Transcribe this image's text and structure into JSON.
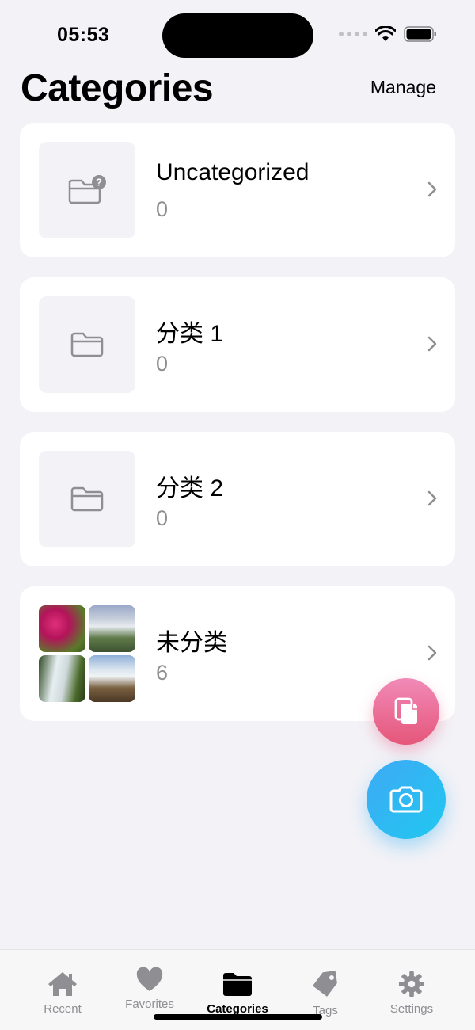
{
  "status": {
    "time": "05:53"
  },
  "header": {
    "title": "Categories",
    "manage_label": "Manage"
  },
  "categories": [
    {
      "name": "Uncategorized",
      "count": "0",
      "icon": "folder-question-icon"
    },
    {
      "name": "分类 1",
      "count": "0",
      "icon": "folder-icon"
    },
    {
      "name": "分类 2",
      "count": "0",
      "icon": "folder-icon"
    },
    {
      "name": "未分类",
      "count": "6",
      "icon": "photo-grid"
    }
  ],
  "fabs": {
    "paste_icon": "paste-icon",
    "camera_icon": "camera-icon"
  },
  "tabs": [
    {
      "label": "Recent",
      "icon": "house-icon"
    },
    {
      "label": "Favorites",
      "icon": "heart-icon"
    },
    {
      "label": "Categories",
      "icon": "folder-fill-icon",
      "active": true
    },
    {
      "label": "Tags",
      "icon": "tag-icon"
    },
    {
      "label": "Settings",
      "icon": "gear-icon"
    }
  ],
  "colors": {
    "background": "#f2f2f7",
    "muted_text": "#8e8e93",
    "paste_fab": "#ec6b97",
    "camera_fab": "#2ab6f3"
  }
}
